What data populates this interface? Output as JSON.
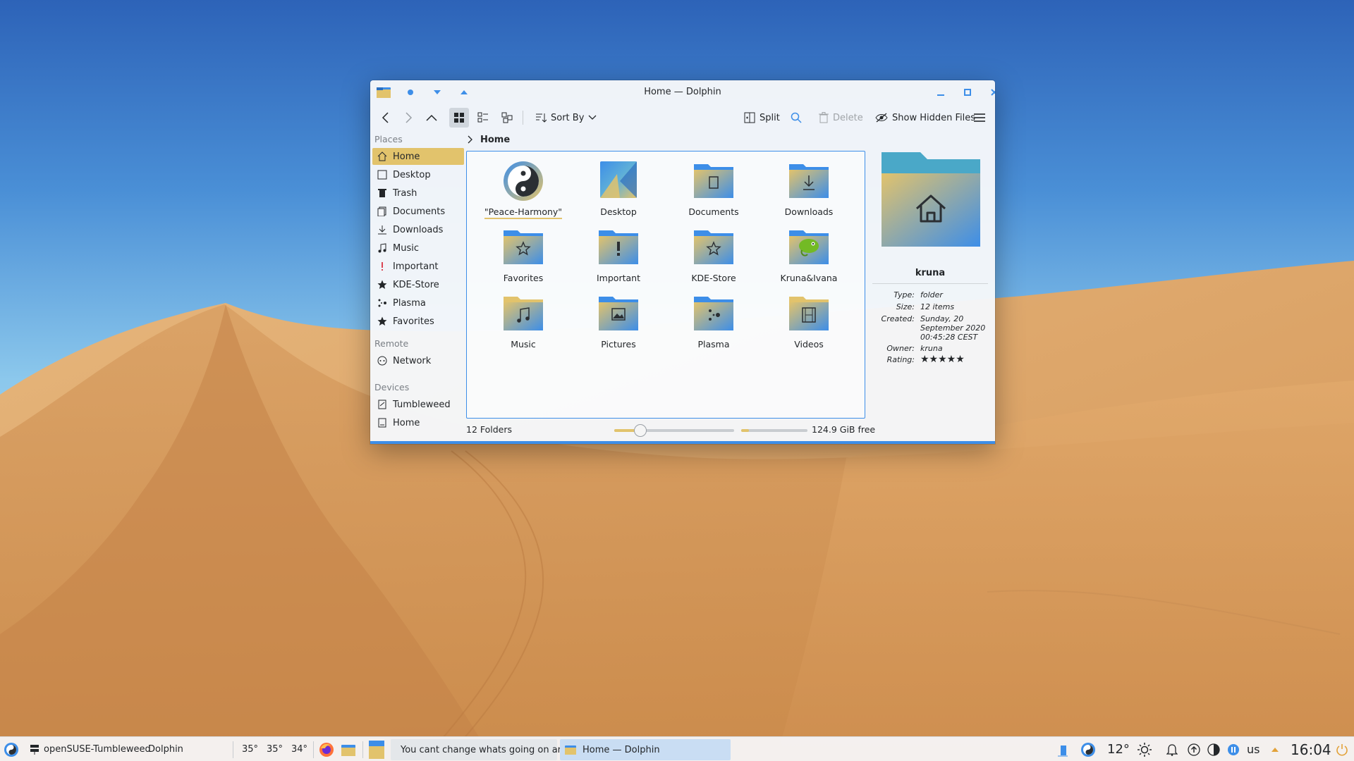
{
  "window": {
    "title": "Home — Dolphin"
  },
  "toolbar": {
    "sort_label": "Sort By",
    "split_label": "Split",
    "delete_label": "Delete",
    "hidden_files_label": "Show Hidden Files"
  },
  "sidebar": {
    "places_title": "Places",
    "places": [
      {
        "label": "Home",
        "icon": "home-icon"
      },
      {
        "label": "Desktop",
        "icon": "desktop-icon"
      },
      {
        "label": "Trash",
        "icon": "trash-icon"
      },
      {
        "label": "Documents",
        "icon": "documents-icon"
      },
      {
        "label": "Downloads",
        "icon": "download-icon"
      },
      {
        "label": "Music",
        "icon": "music-icon"
      },
      {
        "label": "Important",
        "icon": "exclamation-icon"
      },
      {
        "label": "KDE-Store",
        "icon": "star-icon"
      },
      {
        "label": "Plasma",
        "icon": "plasma-icon"
      },
      {
        "label": "Favorites",
        "icon": "star-icon"
      }
    ],
    "remote_title": "Remote",
    "remote": [
      {
        "label": "Network",
        "icon": "network-icon"
      }
    ],
    "devices_title": "Devices",
    "devices": [
      {
        "label": "Tumbleweed",
        "icon": "drive-icon"
      },
      {
        "label": "Home",
        "icon": "drive-icon"
      }
    ]
  },
  "breadcrumb": {
    "current": "Home"
  },
  "files": [
    {
      "label": "\"Peace-Harmony\"",
      "icon": "yin-yang-icon"
    },
    {
      "label": "Desktop",
      "icon": "desktop-folder-icon"
    },
    {
      "label": "Documents",
      "icon": "documents-folder-icon"
    },
    {
      "label": "Downloads",
      "icon": "downloads-folder-icon"
    },
    {
      "label": "Favorites",
      "icon": "favorites-folder-icon"
    },
    {
      "label": "Important",
      "icon": "important-folder-icon"
    },
    {
      "label": "KDE-Store",
      "icon": "kde-store-folder-icon"
    },
    {
      "label": "Kruna&Ivana",
      "icon": "chameleon-folder-icon"
    },
    {
      "label": "Music",
      "icon": "music-folder-icon"
    },
    {
      "label": "Pictures",
      "icon": "pictures-folder-icon"
    },
    {
      "label": "Plasma",
      "icon": "plasma-folder-icon"
    },
    {
      "label": "Videos",
      "icon": "videos-folder-icon"
    }
  ],
  "statusbar": {
    "count": "12 Folders",
    "zoom_fraction": 0.22,
    "space_used_fraction": 0.12,
    "space_text": "124.9 GiB free"
  },
  "info": {
    "name": "kruna",
    "type_key": "Type:",
    "type_val": "folder",
    "size_key": "Size:",
    "size_val": "12 items",
    "created_key": "Created:",
    "created_val": "Sunday, 20 September 2020 00:45:28 CEST",
    "owner_key": "Owner:",
    "owner_val": "kruna",
    "rating_key": "Rating:",
    "rating_val": "★★★★★",
    "rating_stars": 5
  },
  "taskbar": {
    "host": "openSUSE-Tumbleweed",
    "app": "Dolphin",
    "temps": [
      "35°",
      "35°",
      "34°"
    ],
    "task1": "You cant change whats going on ar...",
    "task2": "Home — Dolphin",
    "weather": "12°",
    "layout": "us",
    "clock": "16:04"
  },
  "colors": {
    "accent": "#3d8ee8",
    "selection": "#e2c36c"
  }
}
